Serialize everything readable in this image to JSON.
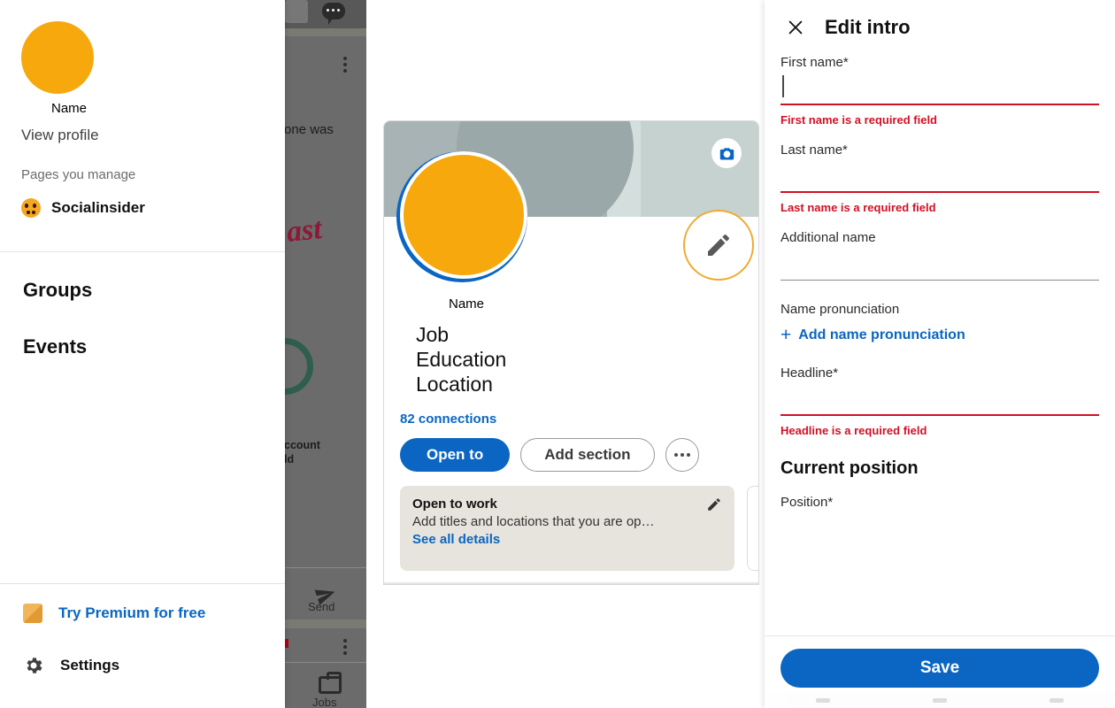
{
  "background_feed": {
    "chat_icon": "chat-bubble-icon",
    "overflow_icon": "kebab-menu-icon",
    "text_fragments": [
      "one was",
      "ast",
      "ccount",
      "ld"
    ],
    "send_label": "Send",
    "jobs_label": "Jobs"
  },
  "sidebar": {
    "avatar": "user-avatar",
    "name": "Name",
    "view_profile": "View profile",
    "pages_heading": "Pages you manage",
    "pages": [
      {
        "label": "Socialinsider",
        "icon": "socialinsider-logo-icon"
      }
    ],
    "nav_items": [
      {
        "label": "Groups"
      },
      {
        "label": "Events"
      }
    ],
    "premium": {
      "label": "Try Premium for free",
      "icon": "premium-badge-icon",
      "color": "#0a66c2"
    },
    "settings": {
      "label": "Settings",
      "icon": "gear-icon"
    }
  },
  "profile_card": {
    "banner": {
      "icon": "camera-icon"
    },
    "edit_profile_icon": "pencil-icon",
    "name": "Name",
    "detail_lines": [
      "Job",
      "Education",
      "Location"
    ],
    "connections": "82 connections",
    "buttons": {
      "open_to": "Open to",
      "add_section": "Add section",
      "more": "more-options-icon"
    },
    "open_to_work": {
      "title": "Open to work",
      "subtitle": "Add titles and locations that you are op…",
      "link": "See all details",
      "edit_icon": "pencil-icon"
    }
  },
  "edit_intro": {
    "close_icon": "close-icon",
    "title": "Edit intro",
    "fields": {
      "first_name": {
        "label": "First name*",
        "value": "",
        "error": "First name is a required field",
        "state": "error"
      },
      "last_name": {
        "label": "Last name*",
        "value": "",
        "error": "Last name is a required field",
        "state": "error"
      },
      "additional_name": {
        "label": "Additional name",
        "value": "",
        "error": "",
        "state": "normal"
      },
      "name_pronunciation": {
        "label": "Name pronunciation",
        "add_label": "Add name pronunciation",
        "add_icon": "plus-icon"
      },
      "headline": {
        "label": "Headline*",
        "value": "",
        "error": "Headline is a required field",
        "state": "error"
      },
      "position": {
        "label": "Position*",
        "value": ""
      }
    },
    "section_current_position": "Current position",
    "save_label": "Save",
    "accent_color": "#0a66c2",
    "error_color": "#d11124"
  }
}
